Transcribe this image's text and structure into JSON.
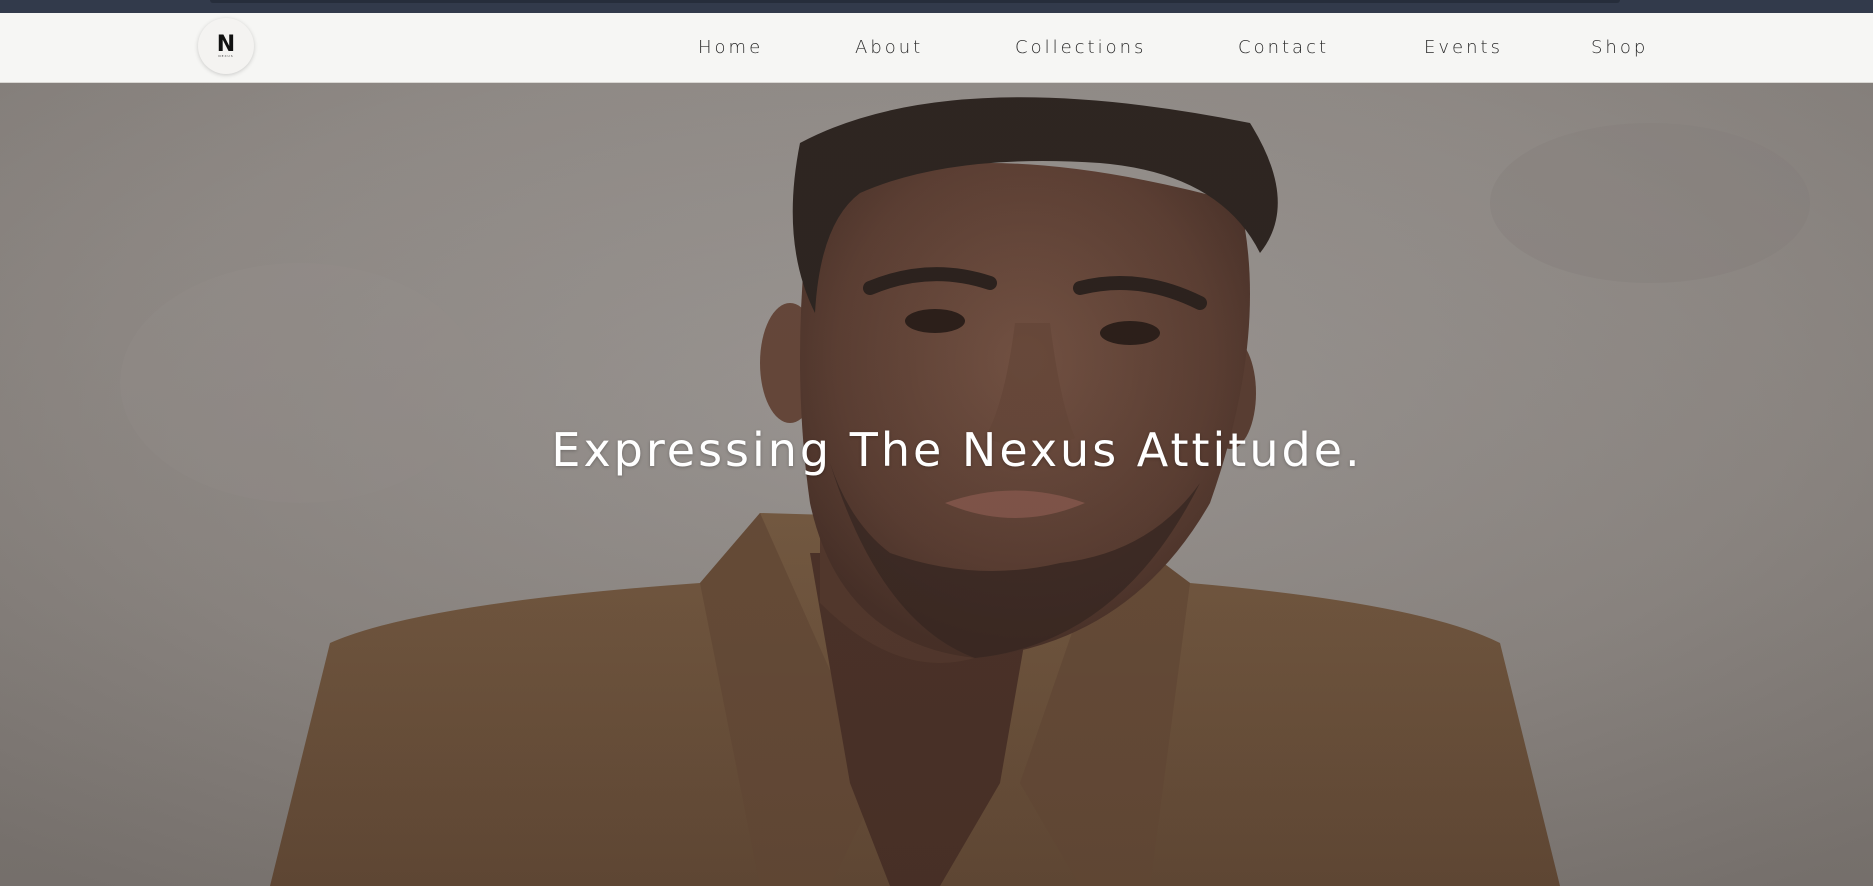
{
  "brand": {
    "logo_letter": "N",
    "logo_sub": "NEXUS"
  },
  "nav": {
    "items": [
      {
        "label": "Home"
      },
      {
        "label": "About"
      },
      {
        "label": "Collections"
      },
      {
        "label": "Contact"
      },
      {
        "label": "Events"
      },
      {
        "label": "Shop"
      }
    ]
  },
  "hero": {
    "title": "Expressing The Nexus Attitude.",
    "image_subject": "portrait of a man in a tan blazer"
  },
  "colors": {
    "topbar": "#323a4b",
    "nav_bg": "#f6f6f4",
    "nav_text": "#2a2a2a",
    "hero_text": "#ffffff"
  }
}
